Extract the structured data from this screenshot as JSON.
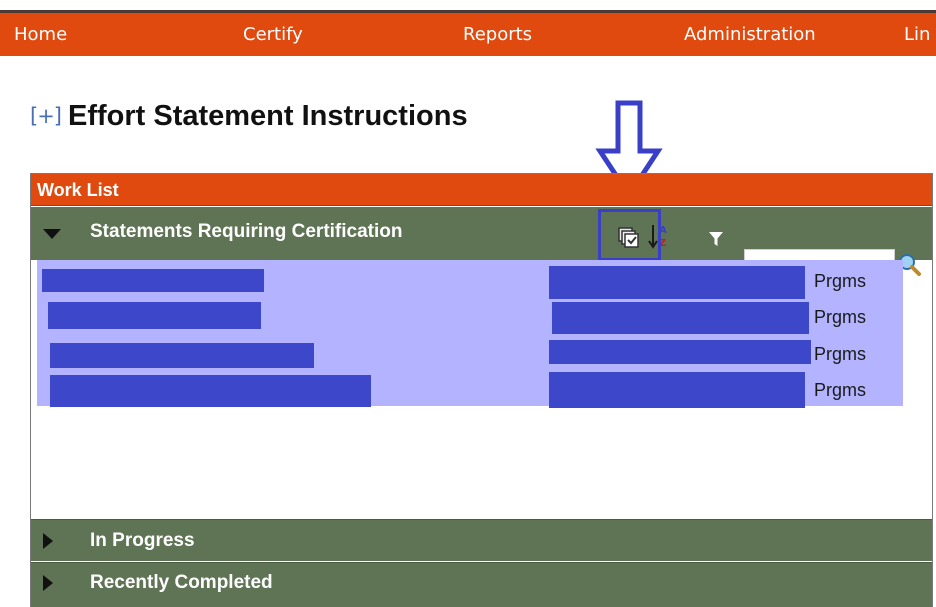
{
  "nav": {
    "items": [
      {
        "label": "Home"
      },
      {
        "label": "Certify"
      },
      {
        "label": "Reports"
      },
      {
        "label": "Administration"
      },
      {
        "label": "Lin"
      }
    ]
  },
  "page": {
    "expand_toggle": "[+]",
    "title": "Effort Statement Instructions"
  },
  "worklist": {
    "header": "Work List",
    "sections": {
      "requiring": {
        "label": "Statements Requiring Certification"
      },
      "in_progress": {
        "label": "In Progress"
      },
      "recently_completed": {
        "label": "Recently Completed"
      }
    },
    "search": {
      "placeholder": "",
      "value": ""
    },
    "rows": [
      {
        "type": "Prgms"
      },
      {
        "type": "Prgms"
      },
      {
        "type": "Prgms"
      },
      {
        "type": "Prgms"
      }
    ]
  },
  "colors": {
    "brand_orange": "#e04a0f",
    "section_green": "#5f7355",
    "row_highlight": "#b3b3ff",
    "redaction_blue": "#3d47c9",
    "annotation_blue": "#3a3fc7"
  },
  "icons": [
    "select-all-icon",
    "sort-icon",
    "filter-icon",
    "search-icon",
    "down-arrow-annotation-icon",
    "expand-icon",
    "collapse-triangle-icon"
  ]
}
